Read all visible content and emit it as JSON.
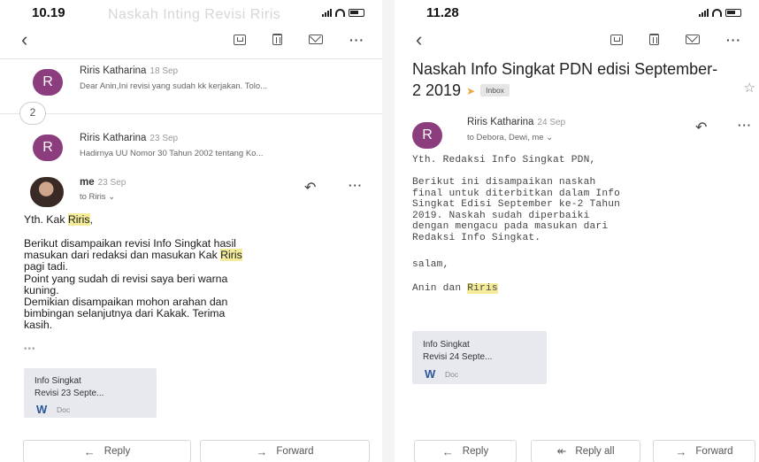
{
  "left": {
    "time": "10.19",
    "faded_title": "Naskah Inting Revisi Riris",
    "thread": [
      {
        "avatar": "R",
        "sender": "Riris Katharina",
        "date": "18 Sep",
        "snippet": "Dear Anin,Ini revisi yang sudah kk kerjakan. Tolo..."
      },
      {
        "avatar": "R",
        "sender": "Riris Katharina",
        "date": "23 Sep",
        "snippet": "Hadirnya UU Nomor 30 Tahun 2002 tentang Ko..."
      }
    ],
    "collapsed_count": "2",
    "open": {
      "sender": "me",
      "date": "23 Sep",
      "to": "to Riris",
      "greeting_pre": "Yth. Kak ",
      "greeting_name": "Riris",
      "greeting_post": ",",
      "para1_pre": "Berikut disampaikan revisi Info Singkat hasil\nmasukan dari redaksi dan masukan Kak ",
      "para1_name": "Riris",
      "para1_post": "\npagi tadi.\nPoint yang sudah di revisi saya beri warna\nkuning.\nDemikian disampaikan mohon arahan dan\nbimbingan selanjutnya dari Kakak. Terima\nkasih.",
      "ellipsis": "•••"
    },
    "attachment": {
      "line1": "Info Singkat",
      "line2": "Revisi 23 Septe...",
      "type": "Doc"
    },
    "actions": {
      "reply": "Reply",
      "forward": "Forward"
    }
  },
  "right": {
    "time": "11.28",
    "subject": "Naskah Info Singkat PDN edisi September-2 2019",
    "label": "Inbox",
    "message": {
      "avatar": "R",
      "sender": "Riris Katharina",
      "date": "24 Sep",
      "to": "to Debora, Dewi, me",
      "line1": "Yth. Redaksi Info Singkat PDN,",
      "para": "Berikut ini disampaikan naskah\nfinal untuk diterbitkan dalam Info\nSingkat Edisi September ke-2 Tahun\n2019. Naskah sudah diperbaiki\ndengan mengacu pada masukan dari\nRedaksi Info Singkat.",
      "closing": "salam,",
      "sign_pre": "Anin dan ",
      "sign_name": "Riris"
    },
    "attachment": {
      "line1": "Info Singkat",
      "line2": "Revisi 24 Septe...",
      "type": "Doc"
    },
    "actions": {
      "reply": "Reply",
      "reply_all": "Reply all",
      "forward": "Forward"
    }
  },
  "icons": {
    "back": "chevron-left-icon",
    "archive": "archive-icon",
    "trash": "trash-icon",
    "mail": "mail-icon",
    "more": "more-icon",
    "reply": "reply-icon",
    "star": "star-icon",
    "word": "word-icon"
  },
  "colors": {
    "avatar": "#8c3d7e",
    "highlight": "#f4ec9a",
    "important_marker": "#e8a93a",
    "word_blue": "#2b579a",
    "attachment_bg": "#e7e9ee"
  }
}
